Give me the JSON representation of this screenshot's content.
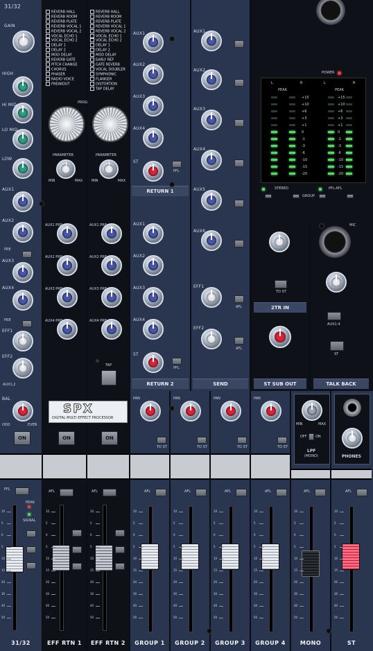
{
  "channel": {
    "id_top": "31/32",
    "gain": "GAIN",
    "eq": [
      "HIGH",
      "HI MID",
      "LO MID",
      "LOW"
    ],
    "aux": [
      "AUX1",
      "AUX2",
      "AUX3",
      "AUX4",
      "EFF1",
      "EFF2"
    ],
    "pre": "PRE",
    "aux_sub": "AUX1,2",
    "bal": "BAL",
    "odd": "ODD",
    "even": "EVEN",
    "on": "ON",
    "pfl": "PFL",
    "peak": "PEAK",
    "signal": "SIGNAL",
    "footer": "31/32"
  },
  "effects": {
    "presets_left": [
      "REVERB HALL",
      "REVERB ROOM",
      "REVERB PLATE",
      "REVERB VOCAL 1",
      "REVERB VOCAL 2",
      "VOCAL ECHO 1",
      "VOCAL ECHO 2",
      "DELAY 1",
      "DELAY 2",
      "MOD DELAY",
      "REVERB GATE",
      "PITCH CHANGE",
      "CHORUS",
      "PHASER",
      "RADIO VOICE",
      "FREAKOUT"
    ],
    "presets_right": [
      "REVERB HALL",
      "REVERB ROOM",
      "REVERB PLATE",
      "REVERB VOCAL 1",
      "REVERB VOCAL 2",
      "VOCAL ECHO 1",
      "VOCAL ECHO 2",
      "DELAY 1",
      "DELAY 2",
      "MOD DELAY",
      "EARLY REF",
      "GATE REVERB",
      "VOCAL DOUBLER",
      "SYMPHONIC",
      "FLANGER",
      "DISTORTION",
      "TAP DELAY"
    ],
    "program": "PROGRAM",
    "parameter": "PARAMETER",
    "min": "MIN",
    "max": "MAX",
    "aux_pre": [
      "AUX1 PRE",
      "AUX2 PRE",
      "AUX3 PRE",
      "AUX4 PRE"
    ],
    "tap": "TAP",
    "spx_logo": "SPX",
    "spx_sub": "DIGITAL MULTI EFFECT PROCESSOR",
    "on": "ON",
    "afl": "AFL",
    "footer1": "EFF RTN 1",
    "footer2": "EFF RTN 2"
  },
  "returns": {
    "aux": [
      "AUX1",
      "AUX2",
      "AUX3",
      "AUX4",
      "ST"
    ],
    "pfl": "PFL",
    "return1": "RETURN 1",
    "return2": "RETURN 2"
  },
  "send": {
    "aux": [
      "AUX1",
      "AUX2",
      "AUX3",
      "AUX4",
      "AUX5",
      "AUX6",
      "EFF1",
      "EFF2"
    ],
    "afl": "AFL",
    "label": "SEND"
  },
  "meter": {
    "power": "POWER",
    "peak": "PEAK",
    "l": "L",
    "r": "R",
    "scale": [
      "+15",
      "+10",
      "+6",
      "+3",
      "+1",
      "0",
      "-1",
      "-3",
      "-6",
      "-10",
      "-15",
      "-20"
    ],
    "stereo": "STEREO",
    "pfl_afl": "PFL-AFL",
    "group": "GROUP"
  },
  "tworin": {
    "to_st": "TO ST",
    "label": "2TR IN",
    "subout": "ST SUB OUT"
  },
  "talkback": {
    "mic": "MIC",
    "aux14": "AUX1-4",
    "st": "ST",
    "label": "TALK BACK"
  },
  "groups": {
    "pan": "PAN",
    "to_st": "TO ST",
    "afl": "AFL",
    "names": [
      "GROUP 1",
      "GROUP 2",
      "GROUP 3",
      "GROUP 4"
    ]
  },
  "mono": {
    "min": "MIN",
    "max": "MAX",
    "off": "OFF",
    "on": "ON",
    "lpf": "LPF",
    "mono_lbl": "(MONO)",
    "afl": "AFL",
    "footer": "MONO"
  },
  "st": {
    "phones": "PHONES",
    "afl": "AFL",
    "footer": "ST"
  },
  "fader_scale": [
    "10",
    "5",
    "0",
    "5",
    "10",
    "15",
    "20",
    "30",
    "40",
    "50"
  ]
}
